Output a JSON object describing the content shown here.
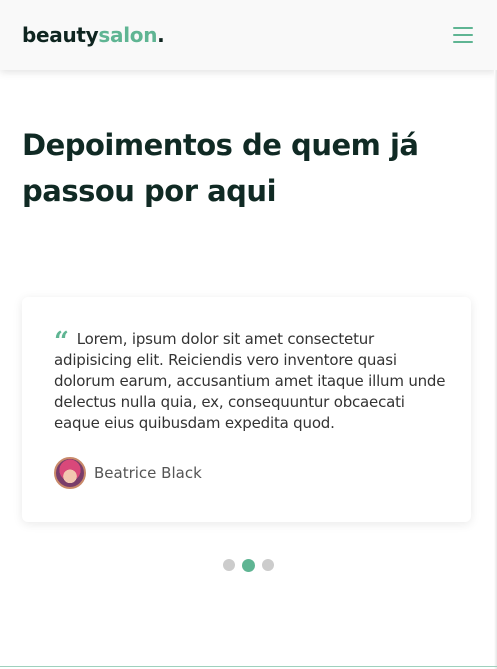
{
  "header": {
    "logo_part1": "beauty",
    "logo_part2": "salon",
    "logo_dot": ".",
    "menu_icon": "hamburger-menu-icon"
  },
  "testimonials": {
    "heading": "Depoimentos de quem já passou por aqui",
    "quote_icon": "quote-icon",
    "quote_mark": "“",
    "quote": "Lorem, ipsum dolor sit amet consectetur adipisicing elit. Reiciendis vero inventore quasi dolorum earum, accusantium amet itaque illum unde delectus nulla quia, ex, consequuntur obcaecati eaque eius quibusdam expedita quod.",
    "author": "Beatrice Black",
    "slide_count": 3,
    "active_slide": 2
  },
  "colors": {
    "accent": "#5fb593",
    "heading": "#102a24"
  }
}
